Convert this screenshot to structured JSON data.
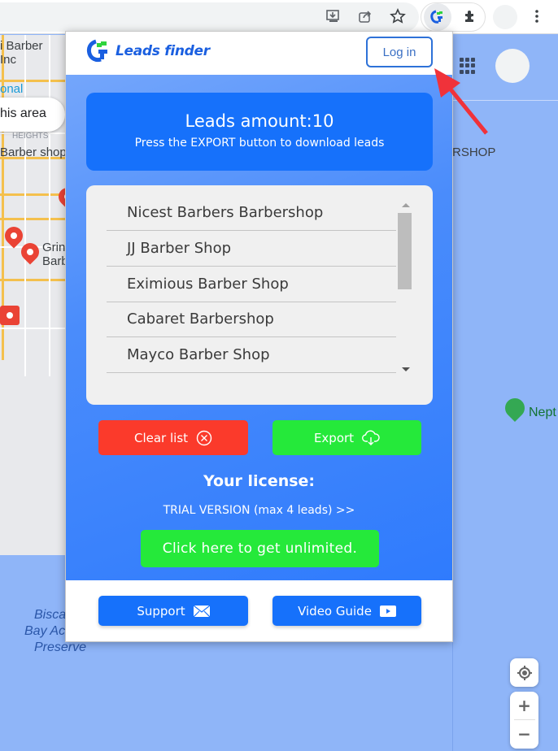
{
  "browser": {
    "toolbar_icons": [
      "install-app-icon",
      "share-icon",
      "bookmark-star-icon",
      "leads-finder-extension-icon",
      "extensions-puzzle-icon",
      "profile-avatar",
      "menu-kebab-icon"
    ]
  },
  "map": {
    "labels": {
      "barber_inc_line1": "i Barber",
      "barber_inc_line2": "Inc",
      "national": "onal",
      "search_area": "his area",
      "heights": "HEIGHTS",
      "barber_shop": "Barber shop",
      "grin_line1": "Grin",
      "grin_line2": "Barb",
      "rshop": "RSHOP",
      "neptune": "Nept",
      "bay_line1": "Bisca",
      "bay_line2": "Bay Ac",
      "bay_line3": "Preserve"
    },
    "controls": {
      "zoom_in": "+",
      "zoom_out": "−"
    }
  },
  "popup": {
    "logo_text": "Leads finder",
    "login_label": "Log in",
    "leads_title": "Leads amount:10",
    "leads_subtitle": "Press the EXPORT button to download leads",
    "leads": [
      "Nicest Barbers Barbershop",
      "JJ Barber Shop",
      "Eximious Barber Shop",
      "Cabaret Barbershop",
      "Mayco Barber Shop"
    ],
    "clear_label": "Clear list",
    "export_label": "Export",
    "license_title": "Your license:",
    "license_type": "TRIAL VERSION (max 4 leads) >>",
    "unlimited_label": "Click here to get unlimited.",
    "support_label": "Support",
    "video_label": "Video Guide"
  },
  "colors": {
    "brand_blue": "#1671fb",
    "clear_red": "#fb3a2b",
    "export_green": "#25e93a",
    "annotation_arrow": "#f0323a"
  }
}
